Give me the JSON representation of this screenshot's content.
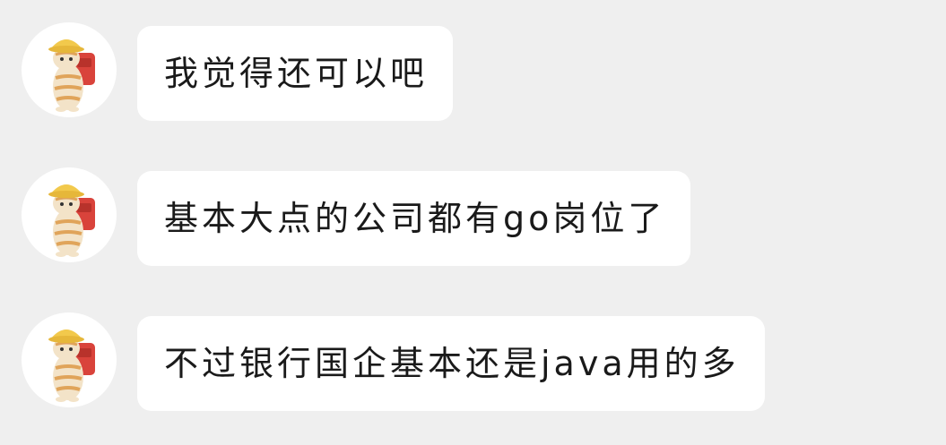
{
  "conversation": {
    "messages": [
      {
        "text": "我觉得还可以吧",
        "avatar_icon": "cat-with-yellow-hat-and-red-backpack-icon"
      },
      {
        "text": "基本大点的公司都有go岗位了",
        "avatar_icon": "cat-with-yellow-hat-and-red-backpack-icon"
      },
      {
        "text": "不过银行国企基本还是java用的多",
        "avatar_icon": "cat-with-yellow-hat-and-red-backpack-icon"
      }
    ]
  },
  "colors": {
    "background": "#efefef",
    "bubble": "#ffffff",
    "text": "#1a1a1a",
    "hat": "#f2c94c",
    "backpack": "#d9433b",
    "cat_fur": "#f3e3c8",
    "cat_stripes": "#e0a45a"
  }
}
